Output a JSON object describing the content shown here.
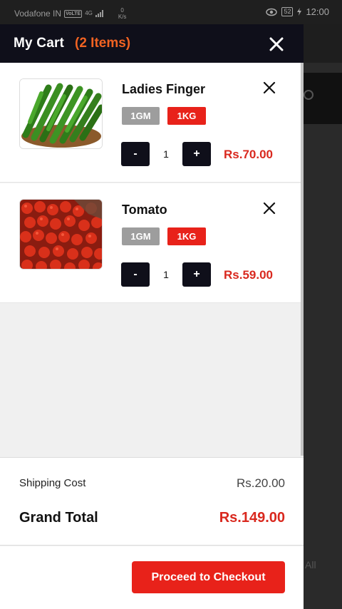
{
  "status_bar": {
    "carrier": "Vodafone IN",
    "volte": "VoLTE",
    "network": "4G",
    "speed_value": "0",
    "speed_unit": "K/s",
    "battery": "52",
    "time": "12:00"
  },
  "background": {
    "partial_text": "All"
  },
  "cart": {
    "title": "My Cart",
    "count_label": "(2 Items)",
    "close_icon": "close-icon",
    "items": [
      {
        "name": "Ladies Finger",
        "image": "okra-product-image",
        "variants": [
          "1GM",
          "1KG"
        ],
        "selected_variant": "1KG",
        "decrement_label": "-",
        "quantity": "1",
        "increment_label": "+",
        "price": "Rs.70.00"
      },
      {
        "name": "Tomato",
        "image": "tomato-product-image",
        "variants": [
          "1GM",
          "1KG"
        ],
        "selected_variant": "1KG",
        "decrement_label": "-",
        "quantity": "1",
        "increment_label": "+",
        "price": "Rs.59.00"
      }
    ],
    "summary": {
      "shipping_label": "Shipping Cost",
      "shipping_value": "Rs.20.00",
      "grand_total_label": "Grand Total",
      "grand_total_value": "Rs.149.00"
    },
    "checkout_label": "Proceed to Checkout"
  },
  "colors": {
    "header_bg": "#0f0f1a",
    "accent_orange": "#f26322",
    "accent_red": "#e8221a",
    "price_red": "#d9281e",
    "chip_gray": "#9d9d9d"
  }
}
